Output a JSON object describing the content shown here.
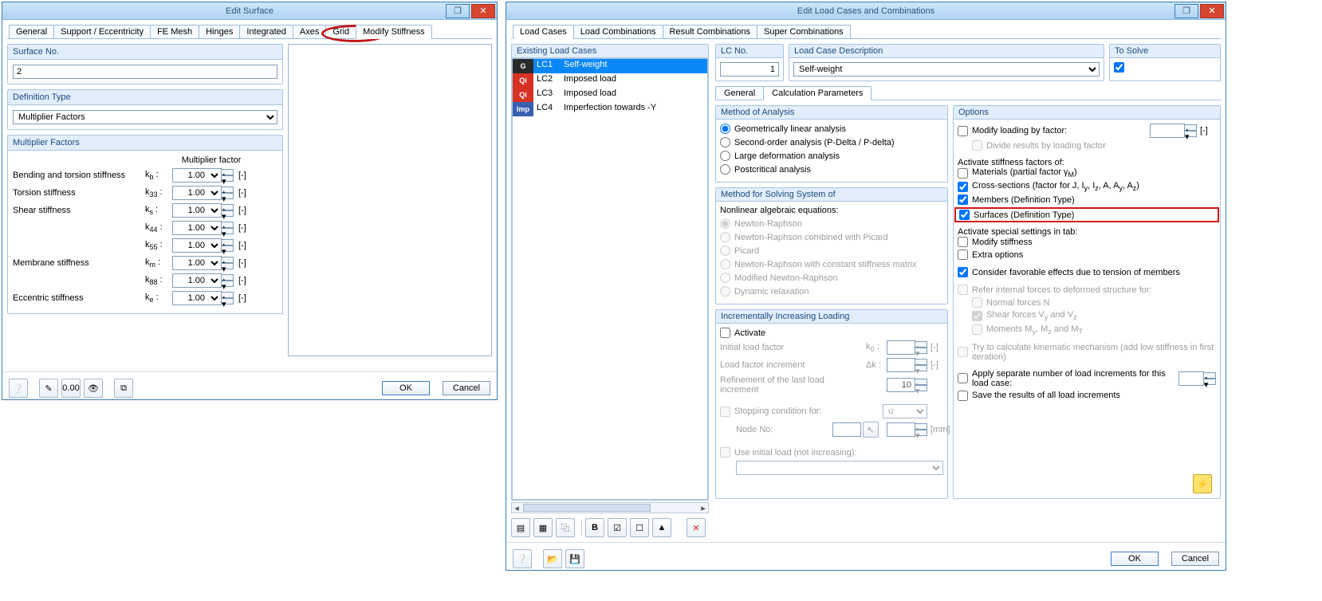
{
  "w1": {
    "title": "Edit Surface",
    "tabs": [
      "General",
      "Support / Eccentricity",
      "FE Mesh",
      "Hinges",
      "Integrated",
      "Axes",
      "Grid",
      "Modify Stiffness"
    ],
    "active_tab": 7,
    "surface_no": {
      "label": "Surface No.",
      "value": "2"
    },
    "def_type": {
      "label": "Definition Type",
      "value": "Multiplier Factors"
    },
    "mf": {
      "label": "Multiplier Factors",
      "col_header": "Multiplier factor",
      "unit": "[-]",
      "rows": [
        {
          "label": "Bending and torsion stiffness",
          "k": "k",
          "sub": "b",
          "val": "1.00"
        },
        {
          "label": "Torsion stiffness",
          "k": "k",
          "sub": "33",
          "val": "1.00"
        },
        {
          "label": "Shear stiffness",
          "k": "k",
          "sub": "s",
          "val": "1.00"
        },
        {
          "label": "",
          "k": "k",
          "sub": "44",
          "val": "1.00"
        },
        {
          "label": "",
          "k": "k",
          "sub": "55",
          "val": "1.00"
        },
        {
          "label": "Membrane stiffness",
          "k": "k",
          "sub": "m",
          "val": "1.00"
        },
        {
          "label": "",
          "k": "k",
          "sub": "88",
          "val": "1.00"
        },
        {
          "label": "Eccentric stiffness",
          "k": "k",
          "sub": "e",
          "val": "1.00"
        }
      ]
    },
    "buttons": {
      "ok": "OK",
      "cancel": "Cancel"
    }
  },
  "w2": {
    "title": "Edit Load Cases and Combinations",
    "tabs": [
      "Load Cases",
      "Load Combinations",
      "Result Combinations",
      "Super Combinations"
    ],
    "active_tab": 0,
    "existing": {
      "label": "Existing Load Cases"
    },
    "lc_list": [
      {
        "tag": "G",
        "tag_color": "#2a2a2a",
        "id": "LC1",
        "desc": "Self-weight",
        "selected": true
      },
      {
        "tag": "Qi",
        "tag_color": "#d63123",
        "id": "LC2",
        "desc": "Imposed load"
      },
      {
        "tag": "Qi",
        "tag_color": "#d63123",
        "id": "LC3",
        "desc": "Imposed load"
      },
      {
        "tag": "Imp",
        "tag_color": "#3a5fb2",
        "id": "LC4",
        "desc": "Imperfection towards -Y"
      }
    ],
    "lc_no": {
      "label": "LC No.",
      "value": "1"
    },
    "lc_desc": {
      "label": "Load Case Description",
      "value": "Self-weight"
    },
    "to_solve": {
      "label": "To Solve",
      "checked": true
    },
    "subtabs": [
      "General",
      "Calculation Parameters"
    ],
    "active_subtab": 1,
    "method_analysis": {
      "label": "Method of Analysis",
      "options": [
        {
          "text": "Geometrically linear analysis",
          "checked": true
        },
        {
          "text": "Second-order analysis (P-Delta / P-delta)"
        },
        {
          "text": "Large deformation analysis"
        },
        {
          "text": "Postcritical analysis"
        }
      ]
    },
    "method_solve": {
      "label": "Method for Solving System of",
      "subtitle": "Nonlinear algebraic equations:",
      "options": [
        {
          "text": "Newton-Raphson",
          "checked": true,
          "disabled": true
        },
        {
          "text": "Newton-Raphson combined with Picard",
          "disabled": true
        },
        {
          "text": "Picard",
          "disabled": true
        },
        {
          "text": "Newton-Raphson with constant stiffness matrix",
          "disabled": true
        },
        {
          "text": "Modified Newton-Raphson",
          "disabled": true
        },
        {
          "text": "Dynamic relaxation",
          "disabled": true
        }
      ]
    },
    "incremental": {
      "label": "Incrementally Increasing Loading",
      "activate": "Activate",
      "rows": {
        "initial": {
          "label": "Initial load factor",
          "k": "k",
          "ksub": "0",
          "unit": "[-]"
        },
        "increment": {
          "label": "Load factor increment",
          "k": "Δk",
          "unit": "[-]"
        },
        "refine": {
          "label": "Refinement of the last load increment",
          "value": "10"
        },
        "stopping": {
          "label": "Stopping condition for:",
          "value": "u"
        },
        "node": {
          "label": "Node No:",
          "unit": "[mm]"
        },
        "initial2": {
          "label": "Use initial load (not increasing):"
        }
      }
    },
    "options": {
      "label": "Options",
      "modify_loading": "Modify loading by factor:",
      "divide_results": "Divide results by loading factor",
      "activate_stiffness": "Activate stiffness factors of:",
      "materials": "Materials (partial factor γ",
      "materials_sub": "M",
      "materials_close": ")",
      "cross": "Cross-sections (factor for J, I",
      "cross_tail": ")",
      "members": "Members (Definition Type)",
      "surfaces": "Surfaces (Definition Type)",
      "activate_special": "Activate special settings in tab:",
      "modify_stiff": "Modify stiffness",
      "extra_opts": "Extra options",
      "consider_fav": "Consider favorable effects due to tension of members",
      "refer_internal": "Refer internal forces to deformed structure for:",
      "normal_n": "Normal forces N",
      "shear_v": "Shear forces V",
      "moments": "Moments M",
      "try_calc": "Try to calculate kinematic mechanism (add low stiffness in first iteration)",
      "apply_sep": "Apply separate number of load increments for this load case:",
      "save_res": "Save the results of all load increments",
      "unit_dash": "[-]"
    },
    "buttons": {
      "ok": "OK",
      "cancel": "Cancel"
    }
  }
}
